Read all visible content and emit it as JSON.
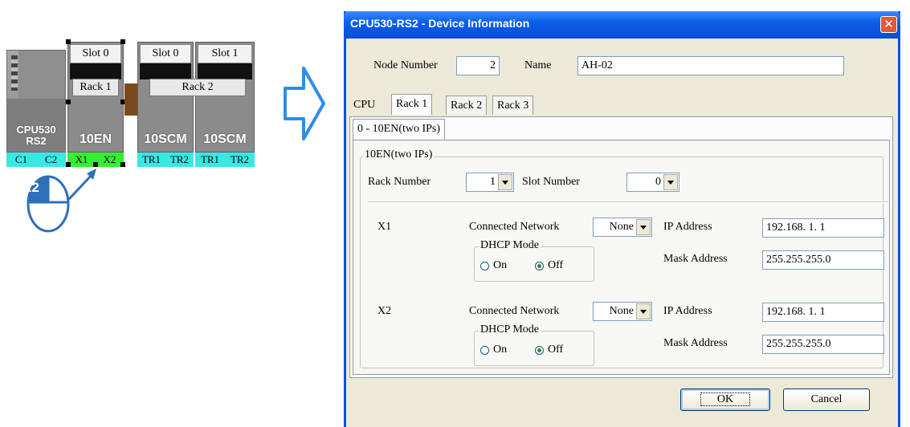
{
  "diagram": {
    "cpu_label_line1": "CPU530",
    "cpu_label_line2": "RS2",
    "cpu_ports": [
      "C1",
      "C2"
    ],
    "slot_rack1": "Slot 0",
    "rack1_label": "Rack 1",
    "module_rack1": "10EN",
    "module_rack1_ports": [
      "X1",
      "X2"
    ],
    "slot_rack2_0": "Slot 0",
    "slot_rack2_1": "Slot 1",
    "rack2_label": "Rack 2",
    "module_rack2_0": "10SCM",
    "module_rack2_1": "10SCM",
    "module_rack2_0_ports": [
      "TR1",
      "TR2"
    ],
    "module_rack2_1_ports": [
      "TR1",
      "TR2"
    ],
    "double_click_badge": "x2",
    "colors": {
      "cpu_port_bar": "#37e8e4",
      "en_port_bar": "#33f033",
      "scm_port_bar": "#37e8e4"
    }
  },
  "dialog": {
    "title": "CPU530-RS2 - Device Information",
    "close_icon": "close-icon",
    "node_number_label": "Node Number",
    "node_number_value": "2",
    "name_label": "Name",
    "name_value": "AH-02",
    "tabs": [
      "CPU",
      "Rack 1",
      "Rack 2",
      "Rack 3"
    ],
    "active_tab": "Rack 1",
    "subtab": "0 - 10EN(two IPs)",
    "group_title": "10EN(two IPs)",
    "rack_number_label": "Rack Number",
    "rack_number_value": "1",
    "slot_number_label": "Slot Number",
    "slot_number_value": "0",
    "ports": [
      {
        "name": "X1",
        "connected_network_label": "Connected Network",
        "connected_network_value": "None",
        "dhcp_title": "DHCP Mode",
        "dhcp_on_label": "On",
        "dhcp_off_label": "Off",
        "dhcp_selected": "Off",
        "ip_label": "IP Address",
        "ip_value": "192.168.  1.  1",
        "mask_label": "Mask Address",
        "mask_value": "255.255.255.0"
      },
      {
        "name": "X2",
        "connected_network_label": "Connected Network",
        "connected_network_value": "None",
        "dhcp_title": "DHCP Mode",
        "dhcp_on_label": "On",
        "dhcp_off_label": "Off",
        "dhcp_selected": "Off",
        "ip_label": "IP Address",
        "ip_value": "192.168.  1.  1",
        "mask_label": "Mask Address",
        "mask_value": "255.255.255.0"
      }
    ],
    "ok_label": "OK",
    "cancel_label": "Cancel"
  }
}
